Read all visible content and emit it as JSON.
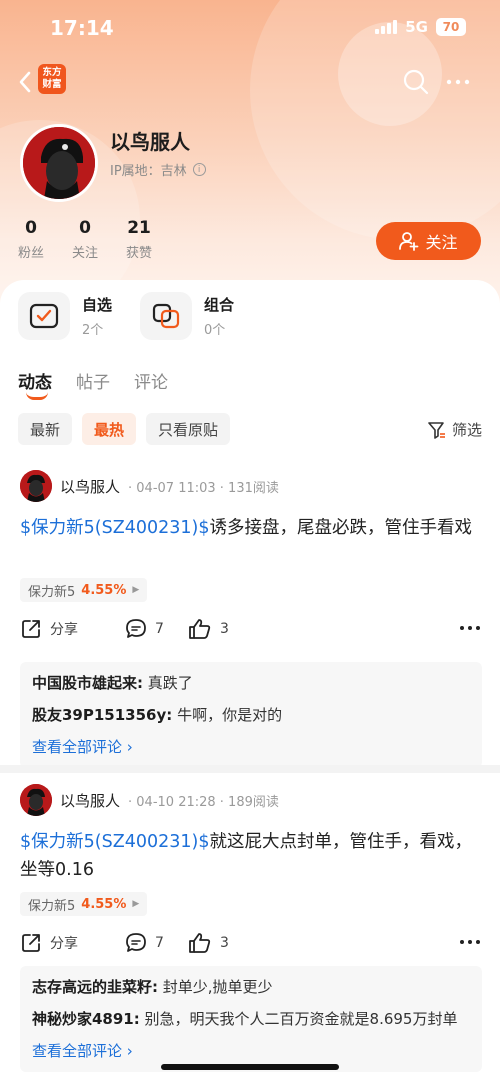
{
  "status_bar": {
    "time": "17:14",
    "network": "5G",
    "battery": "70"
  },
  "header": {
    "app_logo": "东方财富"
  },
  "profile": {
    "username": "以鸟服人",
    "ip_location": "IP属地：吉林",
    "stats": [
      {
        "num": "0",
        "label": "粉丝"
      },
      {
        "num": "0",
        "label": "关注"
      },
      {
        "num": "21",
        "label": "获赞"
      }
    ],
    "follow_label": "关注"
  },
  "quick_cards": [
    {
      "title": "自选",
      "sub": "2个"
    },
    {
      "title": "组合",
      "sub": "0个"
    }
  ],
  "tabs": [
    "动态",
    "帖子",
    "评论"
  ],
  "filters": {
    "chips": [
      "最新",
      "最热",
      "只看原贴"
    ],
    "filter_label": "筛选"
  },
  "posts": [
    {
      "author": "以鸟服人",
      "meta": "· 04-07 11:03 · 131阅读",
      "stock_link": "$保力新5(SZ400231)$",
      "text": "诱多接盘，尾盘必跌，管住手看戏",
      "tag_name": "保力新5",
      "tag_pct": "4.55%",
      "share_label": "分享",
      "comment_count": "7",
      "like_count": "3",
      "comments": [
        {
          "user": "中国股市雄起来:",
          "text": "真跌了"
        },
        {
          "user": "股友39P151356y:",
          "text": "牛啊，你是对的"
        }
      ],
      "see_all": "查看全部评论"
    },
    {
      "author": "以鸟服人",
      "meta": "· 04-10 21:28 · 189阅读",
      "stock_link": "$保力新5(SZ400231)$",
      "text": "就这屁大点封单，管住手，看戏，坐等0.16",
      "tag_name": "保力新5",
      "tag_pct": "4.55%",
      "share_label": "分享",
      "comment_count": "7",
      "like_count": "3",
      "comments": [
        {
          "user": "志存高远的韭菜籽:",
          "text": "封单少,抛单更少"
        },
        {
          "user": "神秘炒家4891:",
          "text": "别急，明天我个人二百万资金就是8.695万封单"
        }
      ],
      "see_all": "查看全部评论"
    }
  ],
  "colors": {
    "accent": "#f15a1c",
    "link": "#1c6fd8",
    "header_top": "#f9b48f"
  }
}
